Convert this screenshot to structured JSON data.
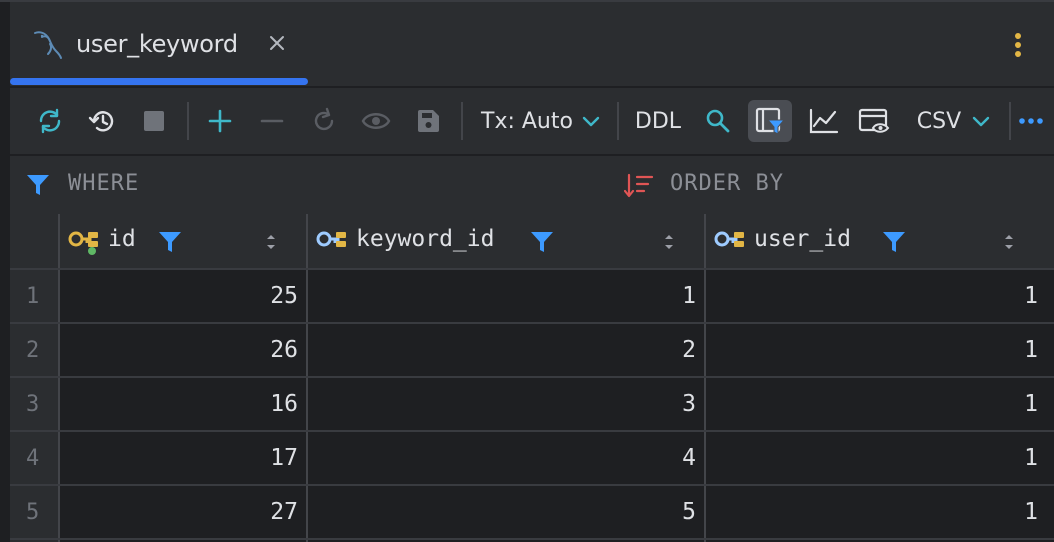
{
  "tab": {
    "title": "user_keyword",
    "icons": {
      "db": "mysql-dolphin-icon",
      "close": "close-icon",
      "more": "more-vertical-icon"
    }
  },
  "toolbar": {
    "tx_label": "Tx: Auto",
    "ddl_label": "DDL",
    "export_label": "CSV",
    "icons": [
      "refresh-icon",
      "history-icon",
      "stop-icon",
      "add-row-icon",
      "remove-row-icon",
      "revert-icon",
      "preview-icon",
      "save-icon",
      "search-icon",
      "filter-panel-icon",
      "chart-icon",
      "view-data-icon",
      "more-horizontal-icon"
    ]
  },
  "filter": {
    "where_label": "WHERE",
    "orderby_label": "ORDER BY"
  },
  "colors": {
    "accent": "#3574f0",
    "filter_blue": "#3d9aff",
    "key_yellow": "#e2b645",
    "order_red": "#e05555"
  },
  "table": {
    "columns": [
      {
        "name": "id"
      },
      {
        "name": "keyword_id"
      },
      {
        "name": "user_id"
      }
    ],
    "rows": [
      {
        "num": "1",
        "cells": [
          "25",
          "1",
          "1"
        ]
      },
      {
        "num": "2",
        "cells": [
          "26",
          "2",
          "1"
        ]
      },
      {
        "num": "3",
        "cells": [
          "16",
          "3",
          "1"
        ]
      },
      {
        "num": "4",
        "cells": [
          "17",
          "4",
          "1"
        ]
      },
      {
        "num": "5",
        "cells": [
          "27",
          "5",
          "1"
        ]
      }
    ]
  }
}
